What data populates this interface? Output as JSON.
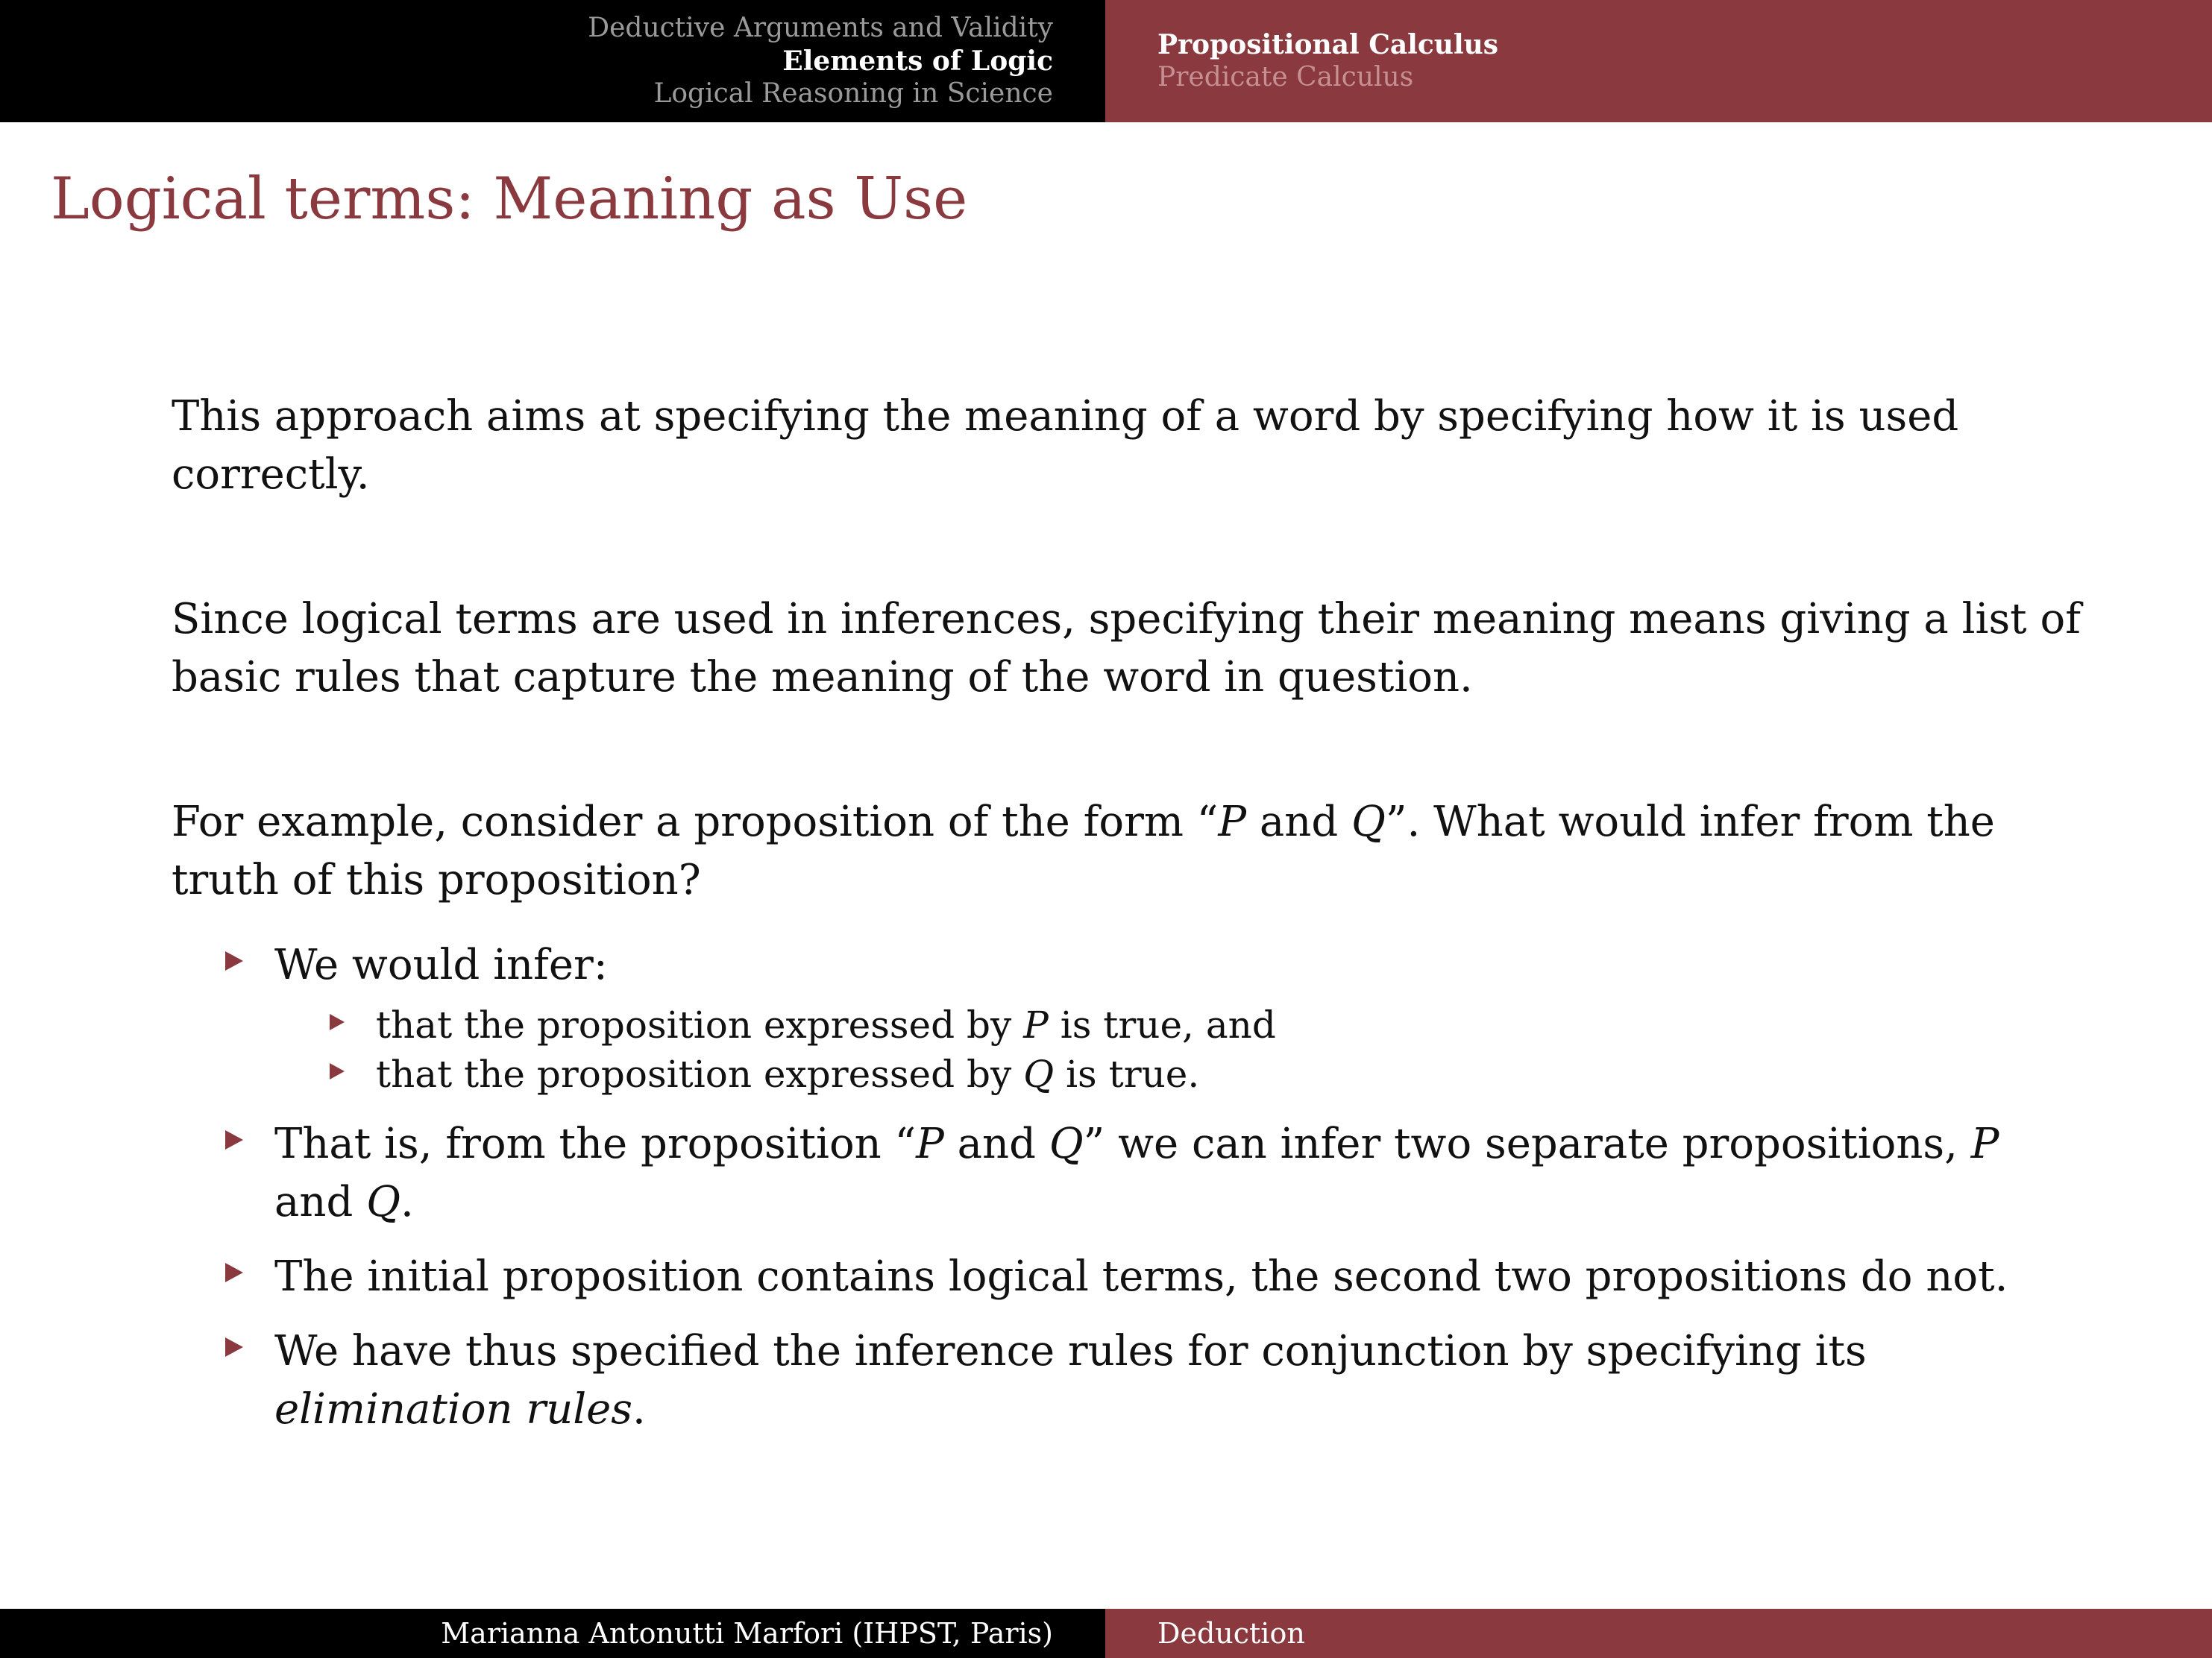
{
  "header": {
    "left_nav": [
      {
        "label": "Deductive Arguments and Validity",
        "active": false
      },
      {
        "label": "Elements of Logic",
        "active": true
      },
      {
        "label": "Logical Reasoning in Science",
        "active": false
      }
    ],
    "right_nav": [
      {
        "label": "Propositional Calculus",
        "active": true
      },
      {
        "label": "Predicate Calculus",
        "active": false
      }
    ]
  },
  "slide": {
    "title": "Logical terms: Meaning as Use",
    "para1": "This approach aims at specifying the meaning of a word by specifying how it is used correctly.",
    "para2": "Since logical terms are used in inferences, specifying their meaning means giving a list of basic rules that capture the meaning of the word in question.",
    "para3": {
      "a": "For example, consider a proposition of the form “",
      "p": "P",
      "b": " and ",
      "q": "Q",
      "c": "”. What would infer from the truth of this proposition?"
    },
    "bullet1": {
      "label": "We would infer:",
      "sub1": {
        "a": "that the proposition expressed by ",
        "v": "P",
        "b": " is true, and"
      },
      "sub2": {
        "a": "that the proposition expressed by ",
        "v": "Q",
        "b": " is true."
      }
    },
    "bullet2": {
      "a": "That is, from the proposition “",
      "p": "P",
      "b": " and ",
      "q": "Q",
      "c": "” we can infer two separate propositions, ",
      "p2": "P",
      "d": " and ",
      "q2": "Q",
      "e": "."
    },
    "bullet3": "The initial proposition contains logical terms, the second two propositions do not.",
    "bullet4": {
      "a": "We have thus specified the inference rules for conjunction by specifying its ",
      "em": "elimination rules",
      "b": "."
    }
  },
  "footer": {
    "author": "Marianna Antonutti Marfori (IHPST, Paris)",
    "topic": "Deduction"
  },
  "colors": {
    "accent": "#8a3a3e",
    "header_bg": "#000000"
  }
}
